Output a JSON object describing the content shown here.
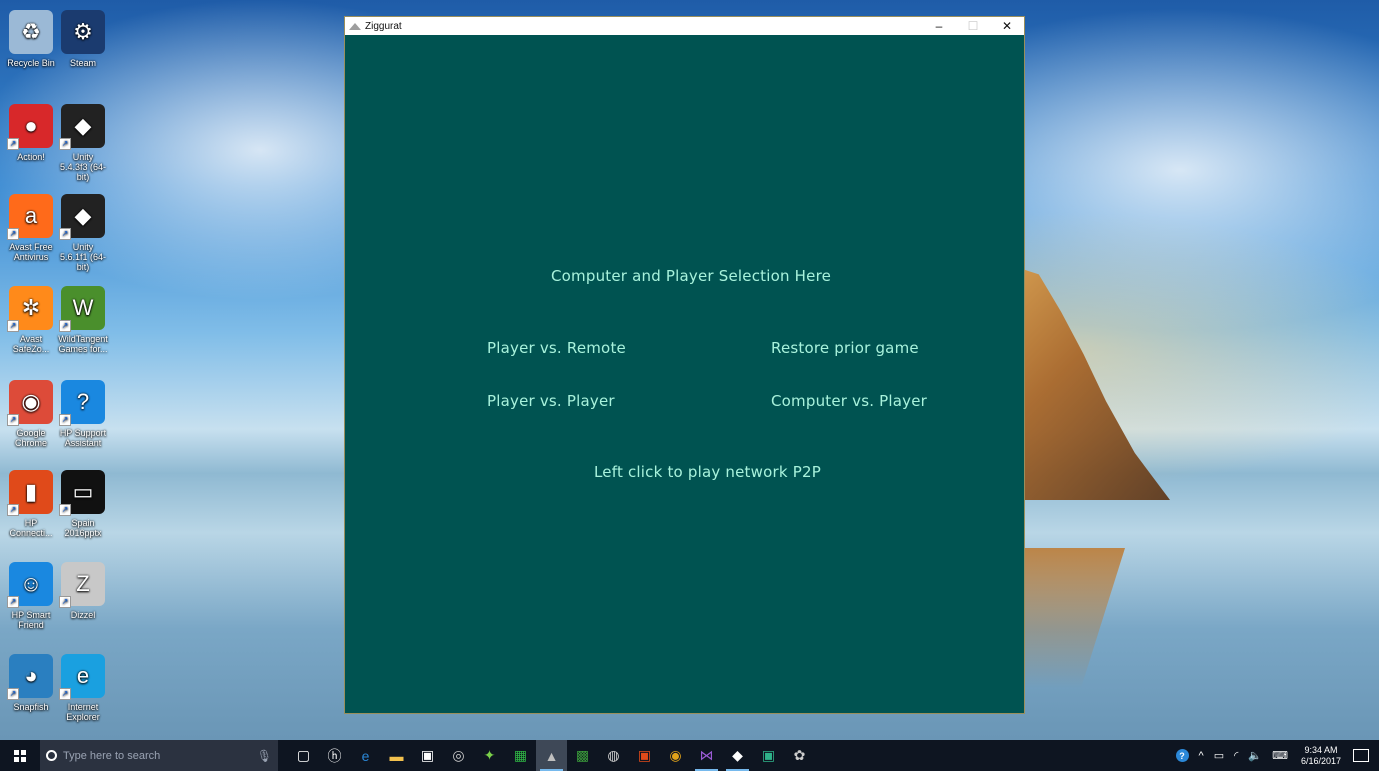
{
  "desktop_icons": [
    {
      "id": "recycle-bin",
      "label": "Recycle Bin",
      "glyph": "♻",
      "color": "#9bb9d6"
    },
    {
      "id": "steam",
      "label": "Steam",
      "glyph": "⚙",
      "color": "#1b3b6f"
    },
    {
      "id": "action",
      "label": "Action!",
      "glyph": "●",
      "color": "#d8282a"
    },
    {
      "id": "unity-543",
      "label": "Unity 5.4.3f3 (64-bit)",
      "glyph": "◆",
      "color": "#222222"
    },
    {
      "id": "avast-antivirus",
      "label": "Avast Free Antivirus",
      "glyph": "a",
      "color": "#ff6a1a"
    },
    {
      "id": "unity-561",
      "label": "Unity 5.6.1f1 (64-bit)",
      "glyph": "◆",
      "color": "#222222"
    },
    {
      "id": "avast-safezone",
      "label": "Avast SafeZo...",
      "glyph": "✲",
      "color": "#ff8a1a"
    },
    {
      "id": "wildtangent",
      "label": "WildTangent Games for...",
      "glyph": "W",
      "color": "#4a8f2c"
    },
    {
      "id": "google-chrome",
      "label": "Google Chrome",
      "glyph": "◉",
      "color": "#dd4b39"
    },
    {
      "id": "hp-support",
      "label": "HP Support Assistant",
      "glyph": "?",
      "color": "#1a88e0"
    },
    {
      "id": "hp-connected",
      "label": "HP Connecti...",
      "glyph": "▮",
      "color": "#e04a1a"
    },
    {
      "id": "spain-2016",
      "label": "Spain 2016pptx",
      "glyph": "▭",
      "color": "#111111"
    },
    {
      "id": "hp-smart-friend",
      "label": "HP Smart Friend",
      "glyph": "☺",
      "color": "#1a88e0"
    },
    {
      "id": "dizzel",
      "label": "Dizzel",
      "glyph": "Z",
      "color": "#c8c8c8"
    },
    {
      "id": "snapfish",
      "label": "Snapfish",
      "glyph": "◕",
      "color": "#2a7fc0"
    },
    {
      "id": "internet-explorer",
      "label": "Internet Explorer",
      "glyph": "e",
      "color": "#1aa0e0"
    }
  ],
  "window": {
    "title": "Ziggurat",
    "minimize": "–",
    "maximize": "☐",
    "close": "✕"
  },
  "menu": {
    "heading": "Computer and Player Selection Here",
    "player_vs_remote": "Player vs. Remote",
    "restore_prior_game": "Restore prior game",
    "player_vs_player": "Player vs. Player",
    "computer_vs_player": "Computer vs. Player",
    "network_p2p": "Left click to play network P2P"
  },
  "colors": {
    "window_bg": "#005351",
    "menu_text": "#a8f2dc",
    "taskbar_bg": "#0e1521"
  },
  "taskbar": {
    "search_placeholder": "Type here to search",
    "apps": [
      {
        "id": "task-view",
        "glyph": "▢",
        "color": "#ffffff"
      },
      {
        "id": "hp",
        "glyph": "ⓗ",
        "color": "#ffffff"
      },
      {
        "id": "edge",
        "glyph": "e",
        "color": "#2b88d8"
      },
      {
        "id": "file-explorer",
        "glyph": "▬",
        "color": "#f2c14e"
      },
      {
        "id": "store",
        "glyph": "▣",
        "color": "#ffffff"
      },
      {
        "id": "app-a",
        "glyph": "◎",
        "color": "#cccccc"
      },
      {
        "id": "app-b",
        "glyph": "✦",
        "color": "#7ad04a"
      },
      {
        "id": "app-c",
        "glyph": "▦",
        "color": "#2fb344"
      },
      {
        "id": "ziggurat",
        "glyph": "▲",
        "color": "#bfbfbf"
      },
      {
        "id": "app-d",
        "glyph": "▩",
        "color": "#3a9a3a"
      },
      {
        "id": "app-e",
        "glyph": "◍",
        "color": "#cfcfcf"
      },
      {
        "id": "app-f",
        "glyph": "▣",
        "color": "#e04a1a"
      },
      {
        "id": "chrome",
        "glyph": "◉",
        "color": "#e0a21a"
      },
      {
        "id": "visual-studio",
        "glyph": "⋈",
        "color": "#9b5bd6"
      },
      {
        "id": "unity",
        "glyph": "◆",
        "color": "#ffffff"
      },
      {
        "id": "app-g",
        "glyph": "▣",
        "color": "#2fb38a"
      },
      {
        "id": "app-h",
        "glyph": "✿",
        "color": "#cccccc"
      }
    ],
    "tray": {
      "help": "?",
      "chevron": "^",
      "clock_time": "9:34 AM",
      "clock_date": "6/16/2017"
    }
  }
}
